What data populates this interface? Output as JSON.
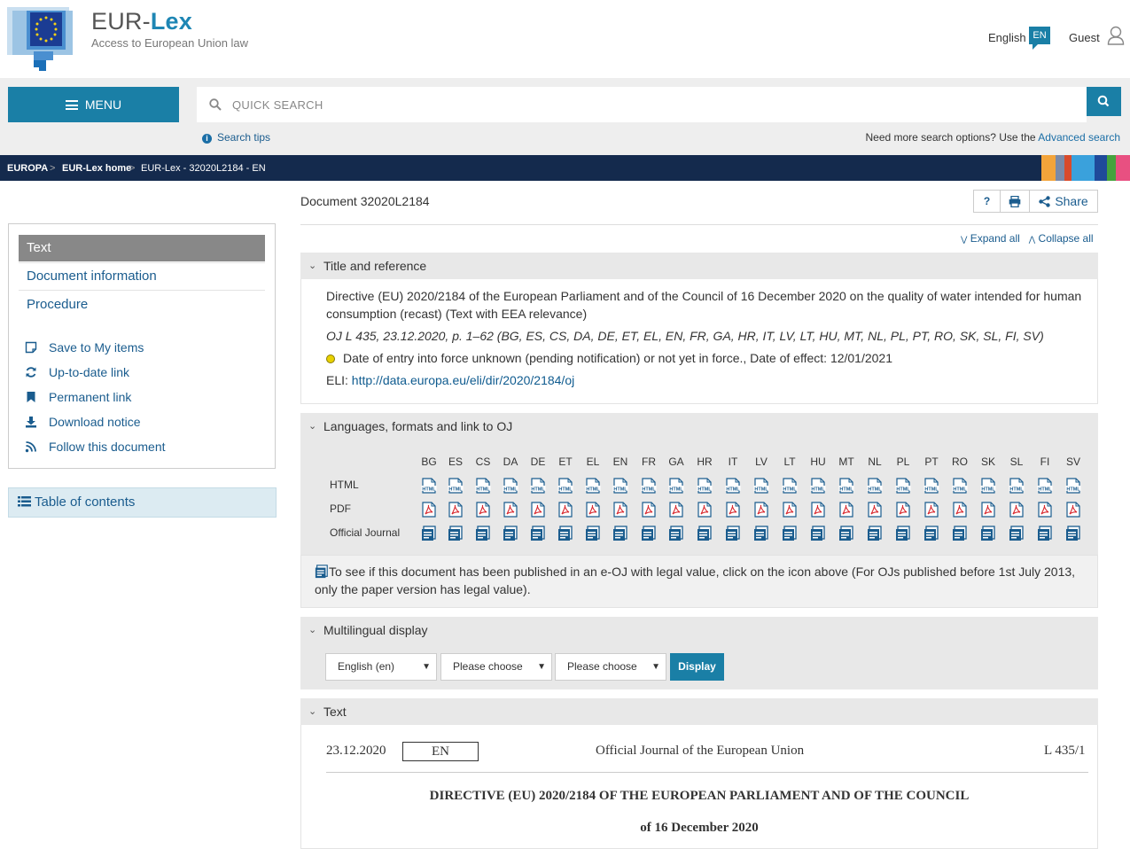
{
  "header": {
    "brand_first": "EUR-",
    "brand_second": "Lex",
    "brand_sub": "Access to European Union law",
    "language": "English",
    "language_code": "EN",
    "user": "Guest"
  },
  "search": {
    "menu_label": "MENU",
    "placeholder": "QUICK SEARCH",
    "tips": "Search tips",
    "more_options": "Need more search options? Use the",
    "advanced": "Advanced search"
  },
  "breadcrumb": [
    "EUROPA",
    "EUR-Lex home",
    "EUR-Lex - 32020L2184 - EN"
  ],
  "breadcrumb_sep": ">",
  "stripe_colors": [
    "#f3a43a",
    "#7b8aa8",
    "#d94a2b",
    "#3aa1dc",
    "#1f4a9a",
    "#44a33d",
    "#e85081"
  ],
  "sidebar": {
    "active": "Text",
    "links": [
      "Document information",
      "Procedure"
    ],
    "tools": [
      "Save to My items",
      "Up-to-date link",
      "Permanent link",
      "Download notice",
      "Follow this document"
    ],
    "toc": "Table of contents"
  },
  "document": {
    "title": "Document 32020L2184",
    "help": "?",
    "share": "Share",
    "expand_all": "Expand all",
    "collapse_all": "Collapse all"
  },
  "title_ref": {
    "heading": "Title and reference",
    "line1": "Directive (EU) 2020/2184 of the European Parliament and of the Council of 16 December 2020 on the quality of water intended for human",
    "line2": "consumption (recast) (Text with EEA relevance)",
    "oj": "OJ L 435, 23.12.2020, p. 1–62 (BG, ES, CS, DA, DE, ET, EL, EN, FR, GA, HR, IT, LV, LT, HU, MT, NL, PL, PT, RO, SK, SL, FI, SV)",
    "status": "Date of entry into force unknown (pending notification) or not yet in force., Date of effect: 12/01/2021",
    "eli_label": "ELI:",
    "eli_link": "http://data.europa.eu/eli/dir/2020/2184/oj"
  },
  "languages": {
    "heading": "Languages, formats and link to OJ",
    "codes": [
      "BG",
      "ES",
      "CS",
      "DA",
      "DE",
      "ET",
      "EL",
      "EN",
      "FR",
      "GA",
      "HR",
      "IT",
      "LV",
      "LT",
      "HU",
      "MT",
      "NL",
      "PL",
      "PT",
      "RO",
      "SK",
      "SL",
      "FI",
      "SV"
    ],
    "rows": [
      "HTML",
      "PDF",
      "Official Journal"
    ],
    "note1": "To see if this document has been published in an e-OJ with legal value, click on the icon above (For OJs published before 1st July 2013,",
    "note2": "only the paper version has legal value)."
  },
  "multilingual": {
    "heading": "Multilingual display",
    "select1": "English (en)",
    "select2": "Please choose",
    "select3": "Please choose",
    "button": "Display"
  },
  "text_section": {
    "heading": "Text",
    "date": "23.12.2020",
    "lang": "EN",
    "journal": "Official Journal of the European Union",
    "ref": "L 435/1",
    "directive_title": "DIRECTIVE (EU) 2020/2184 OF THE EUROPEAN PARLIAMENT AND OF THE COUNCIL",
    "of_date": "of 16 December 2020"
  }
}
